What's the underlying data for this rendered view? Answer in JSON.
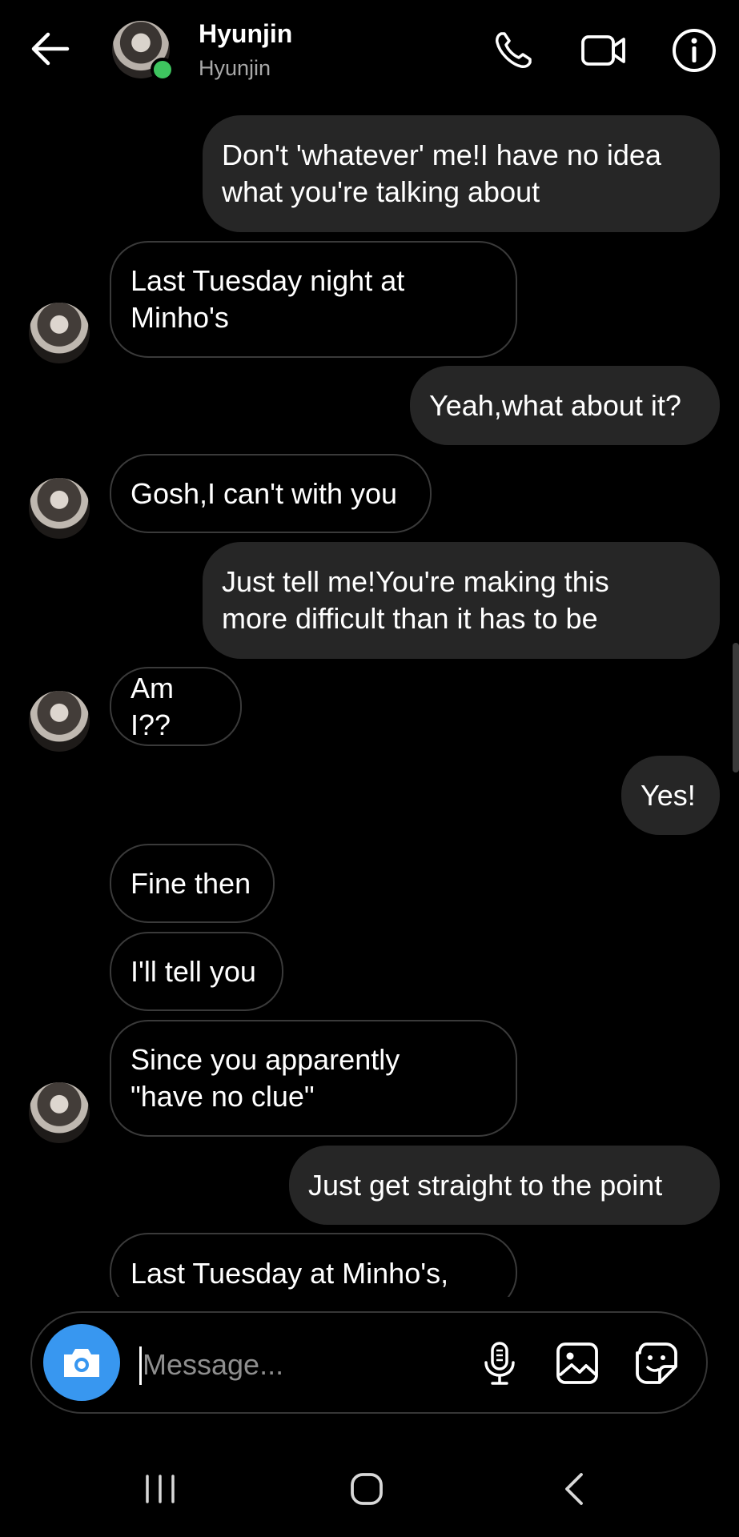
{
  "header": {
    "name": "Hyunjin",
    "username": "Hyunjin"
  },
  "messages": [
    {
      "from": "me",
      "lines": [
        "Don't 'whatever' me!I have no idea",
        "what you're talking about"
      ]
    },
    {
      "from": "them",
      "lines": [
        "Last Tuesday night at",
        "Minho's"
      ]
    },
    {
      "from": "me",
      "lines": [
        "Yeah,what about it?"
      ]
    },
    {
      "from": "them",
      "lines": [
        "Gosh,I can't with you"
      ]
    },
    {
      "from": "me",
      "lines": [
        "Just tell me!You're making this",
        "more difficult than it has to be"
      ]
    },
    {
      "from": "them",
      "lines": [
        "Am I??"
      ]
    },
    {
      "from": "me",
      "lines": [
        "Yes!"
      ]
    },
    {
      "from": "them",
      "lines": [
        "Fine then"
      ]
    },
    {
      "from": "them",
      "lines": [
        "I'll tell you"
      ]
    },
    {
      "from": "them",
      "lines": [
        "Since you apparently",
        "\"have no clue\""
      ]
    },
    {
      "from": "me",
      "lines": [
        "Just get straight to the point"
      ]
    },
    {
      "from": "them",
      "lines": [
        "Last Tuesday at Minho's,"
      ]
    }
  ],
  "composer": {
    "placeholder": "Message..."
  },
  "colors": {
    "background": "#000000",
    "outgoing_bubble": "#262626",
    "incoming_border": "#3a3a3a",
    "accent_blue": "#3897f0",
    "online": "#3ec45f"
  },
  "icons": [
    "back-arrow-icon",
    "phone-icon",
    "video-icon",
    "info-icon",
    "camera-icon",
    "microphone-icon",
    "gallery-icon",
    "sticker-icon",
    "recents-icon",
    "home-icon",
    "nav-back-icon"
  ]
}
